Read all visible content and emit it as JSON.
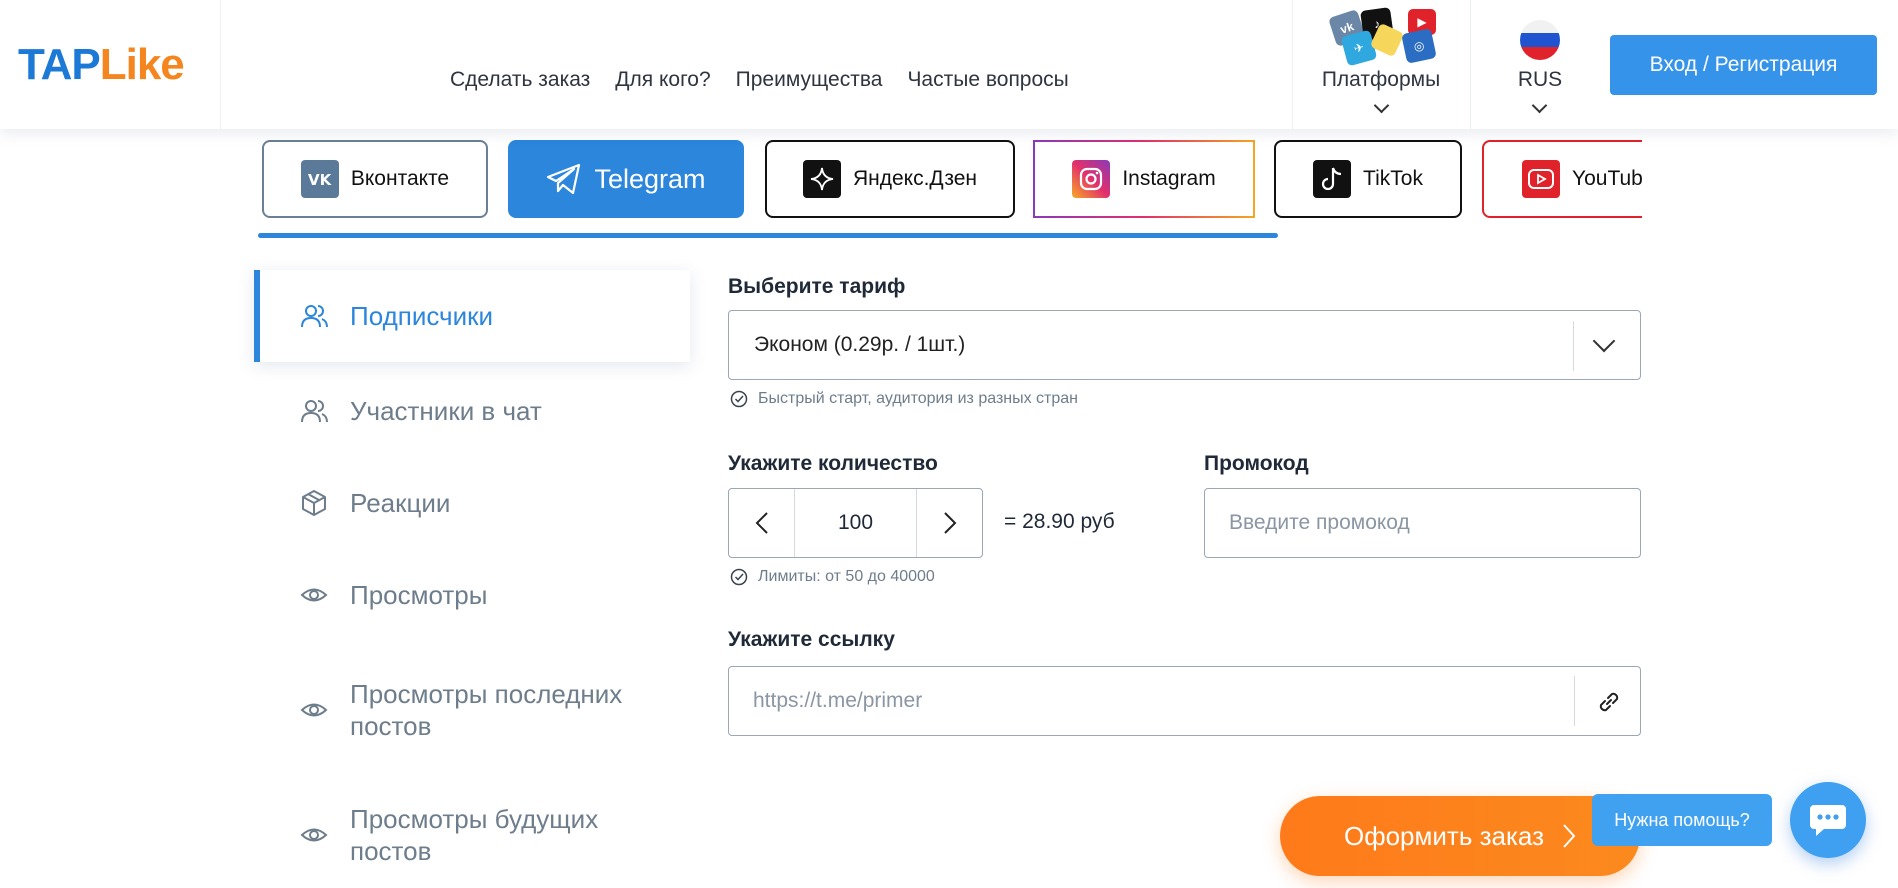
{
  "header": {
    "logo_tap": "TAP",
    "logo_like": "Like",
    "nav": [
      "Сделать заказ",
      "Для кого?",
      "Преимущества",
      "Частые вопросы"
    ],
    "platforms_label": "Платформы",
    "language": "RUS",
    "login_label": "Вход / Регистрация"
  },
  "platform_tabs": [
    {
      "label": "Вконтакте",
      "icon": "vk-icon"
    },
    {
      "label": "Telegram",
      "icon": "telegram-icon",
      "active": true
    },
    {
      "label": "Яндекс.Дзен",
      "icon": "dzen-icon"
    },
    {
      "label": "Instagram",
      "icon": "instagram-icon"
    },
    {
      "label": "TikTok",
      "icon": "tiktok-icon"
    },
    {
      "label": "YouTube",
      "icon": "youtube-icon"
    }
  ],
  "sidebar": {
    "items": [
      {
        "label": "Подписчики",
        "icon": "users-icon",
        "active": true
      },
      {
        "label": "Участники в чат",
        "icon": "users-icon"
      },
      {
        "label": "Реакции",
        "icon": "cube-icon"
      },
      {
        "label": "Просмотры",
        "icon": "eye-icon"
      },
      {
        "label": "Просмотры последних постов",
        "icon": "eye-icon"
      },
      {
        "label": "Просмотры будущих постов",
        "icon": "eye-icon"
      }
    ]
  },
  "form": {
    "tariff_label": "Выберите тариф",
    "tariff_value": "Эконом (0.29р. / 1шт.)",
    "tariff_hint": "Быстрый старт, аудитория из разных стран",
    "quantity_label": "Укажите количество",
    "quantity_value": "100",
    "price": "= 28.90 руб",
    "quantity_hint": "Лимиты: от 50 до 40000",
    "promo_label": "Промокод",
    "promo_placeholder": "Введите промокод",
    "link_label": "Укажите ссылку",
    "link_placeholder": "https://t.me/primer"
  },
  "order_button": "Оформить заказ",
  "help_bubble": "Нужна помощь?",
  "colors": {
    "accent": "#2b86dc",
    "logo_blue": "#1d79d6",
    "logo_orange": "#f5861f",
    "order": "#ff7a1a",
    "muted": "#6e7d8c"
  }
}
